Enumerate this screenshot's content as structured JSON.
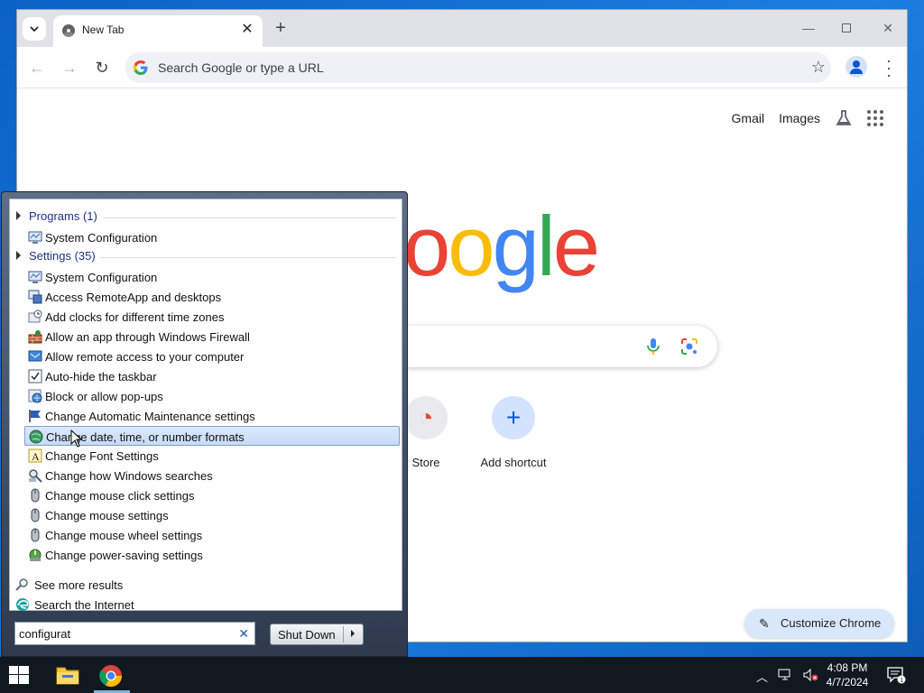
{
  "browser": {
    "tab_title": "New Tab",
    "omnibox_placeholder": "Search Google or type a URL",
    "top_links": {
      "gmail": "Gmail",
      "images": "Images"
    },
    "logo_text": "oogle",
    "shortcuts": [
      {
        "label": "Store"
      },
      {
        "label": "Add shortcut"
      }
    ],
    "customize_label": "Customize Chrome"
  },
  "start_menu": {
    "groups": {
      "programs": "Programs (1)",
      "settings": "Settings (35)"
    },
    "program_items": [
      {
        "label": "System Configuration",
        "icon": "msconfig-icon"
      }
    ],
    "setting_items": [
      {
        "label": "System Configuration",
        "icon": "msconfig-icon"
      },
      {
        "label": "Access RemoteApp and desktops",
        "icon": "remoteapp-icon"
      },
      {
        "label": "Add clocks for different time zones",
        "icon": "clock-icon"
      },
      {
        "label": "Allow an app through Windows Firewall",
        "icon": "firewall-icon"
      },
      {
        "label": "Allow remote access to your computer",
        "icon": "remote-access-icon"
      },
      {
        "label": "Auto-hide the taskbar",
        "icon": "taskbar-icon"
      },
      {
        "label": "Block or allow pop-ups",
        "icon": "internet-options-icon"
      },
      {
        "label": "Change Automatic Maintenance settings",
        "icon": "flag-icon"
      },
      {
        "label": "Change date, time, or number formats",
        "icon": "region-icon",
        "selected": true
      },
      {
        "label": "Change Font Settings",
        "icon": "font-icon"
      },
      {
        "label": "Change how Windows searches",
        "icon": "indexing-icon"
      },
      {
        "label": "Change mouse click settings",
        "icon": "mouse-icon"
      },
      {
        "label": "Change mouse settings",
        "icon": "mouse-icon"
      },
      {
        "label": "Change mouse wheel settings",
        "icon": "mouse-icon"
      },
      {
        "label": "Change power-saving settings",
        "icon": "power-icon"
      }
    ],
    "see_more": "See more results",
    "search_internet": "Search the Internet",
    "search_value": "configurat",
    "shutdown_label": "Shut Down"
  },
  "taskbar": {
    "time": "4:08 PM",
    "date": "4/7/2024",
    "notification_count": "1"
  },
  "colors": {
    "desktop": "#1565c0",
    "selection": "#c6dbf6",
    "group_header": "#1e3287",
    "customize_bg": "#d9e7fb"
  }
}
